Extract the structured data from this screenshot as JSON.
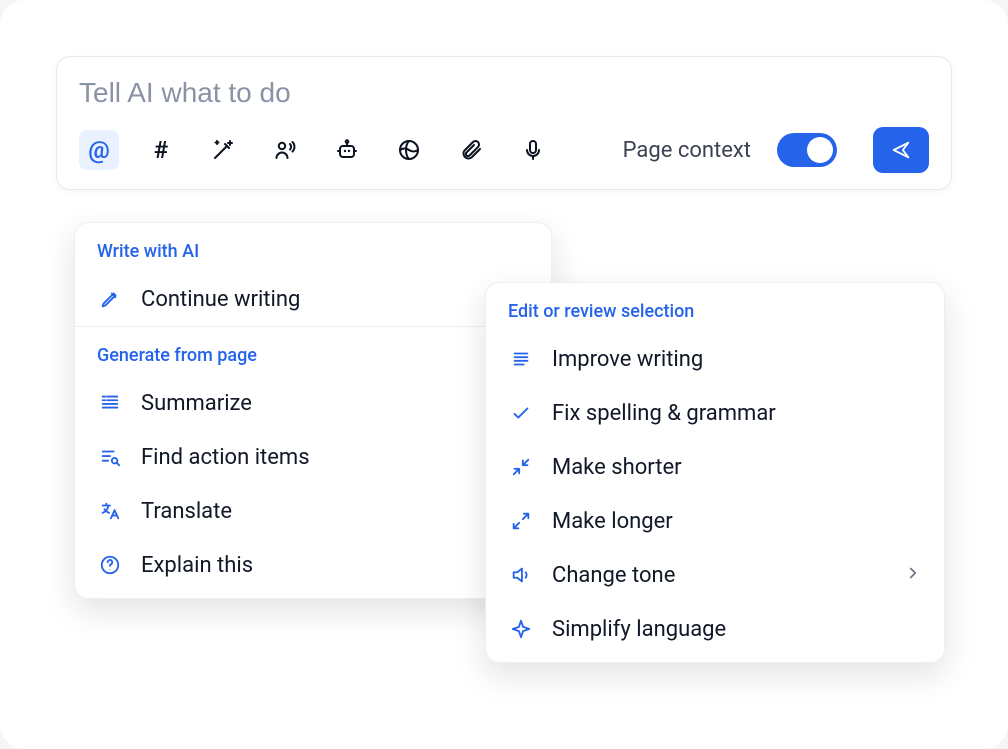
{
  "prompt": {
    "placeholder": "Tell AI what to do",
    "page_context_label": "Page context",
    "page_context_on": true
  },
  "panels": {
    "left": {
      "section1_title": "Write with AI",
      "section1_items": {
        "continue": "Continue writing"
      },
      "section2_title": "Generate from page",
      "section2_items": {
        "summarize": "Summarize",
        "find_actions": "Find action items",
        "translate": "Translate",
        "explain": "Explain this"
      }
    },
    "right": {
      "title": "Edit or review selection",
      "items": {
        "improve": "Improve writing",
        "fix": "Fix spelling & grammar",
        "shorter": "Make shorter",
        "longer": "Make longer",
        "tone": "Change tone",
        "simplify": "Simplify language"
      }
    }
  }
}
